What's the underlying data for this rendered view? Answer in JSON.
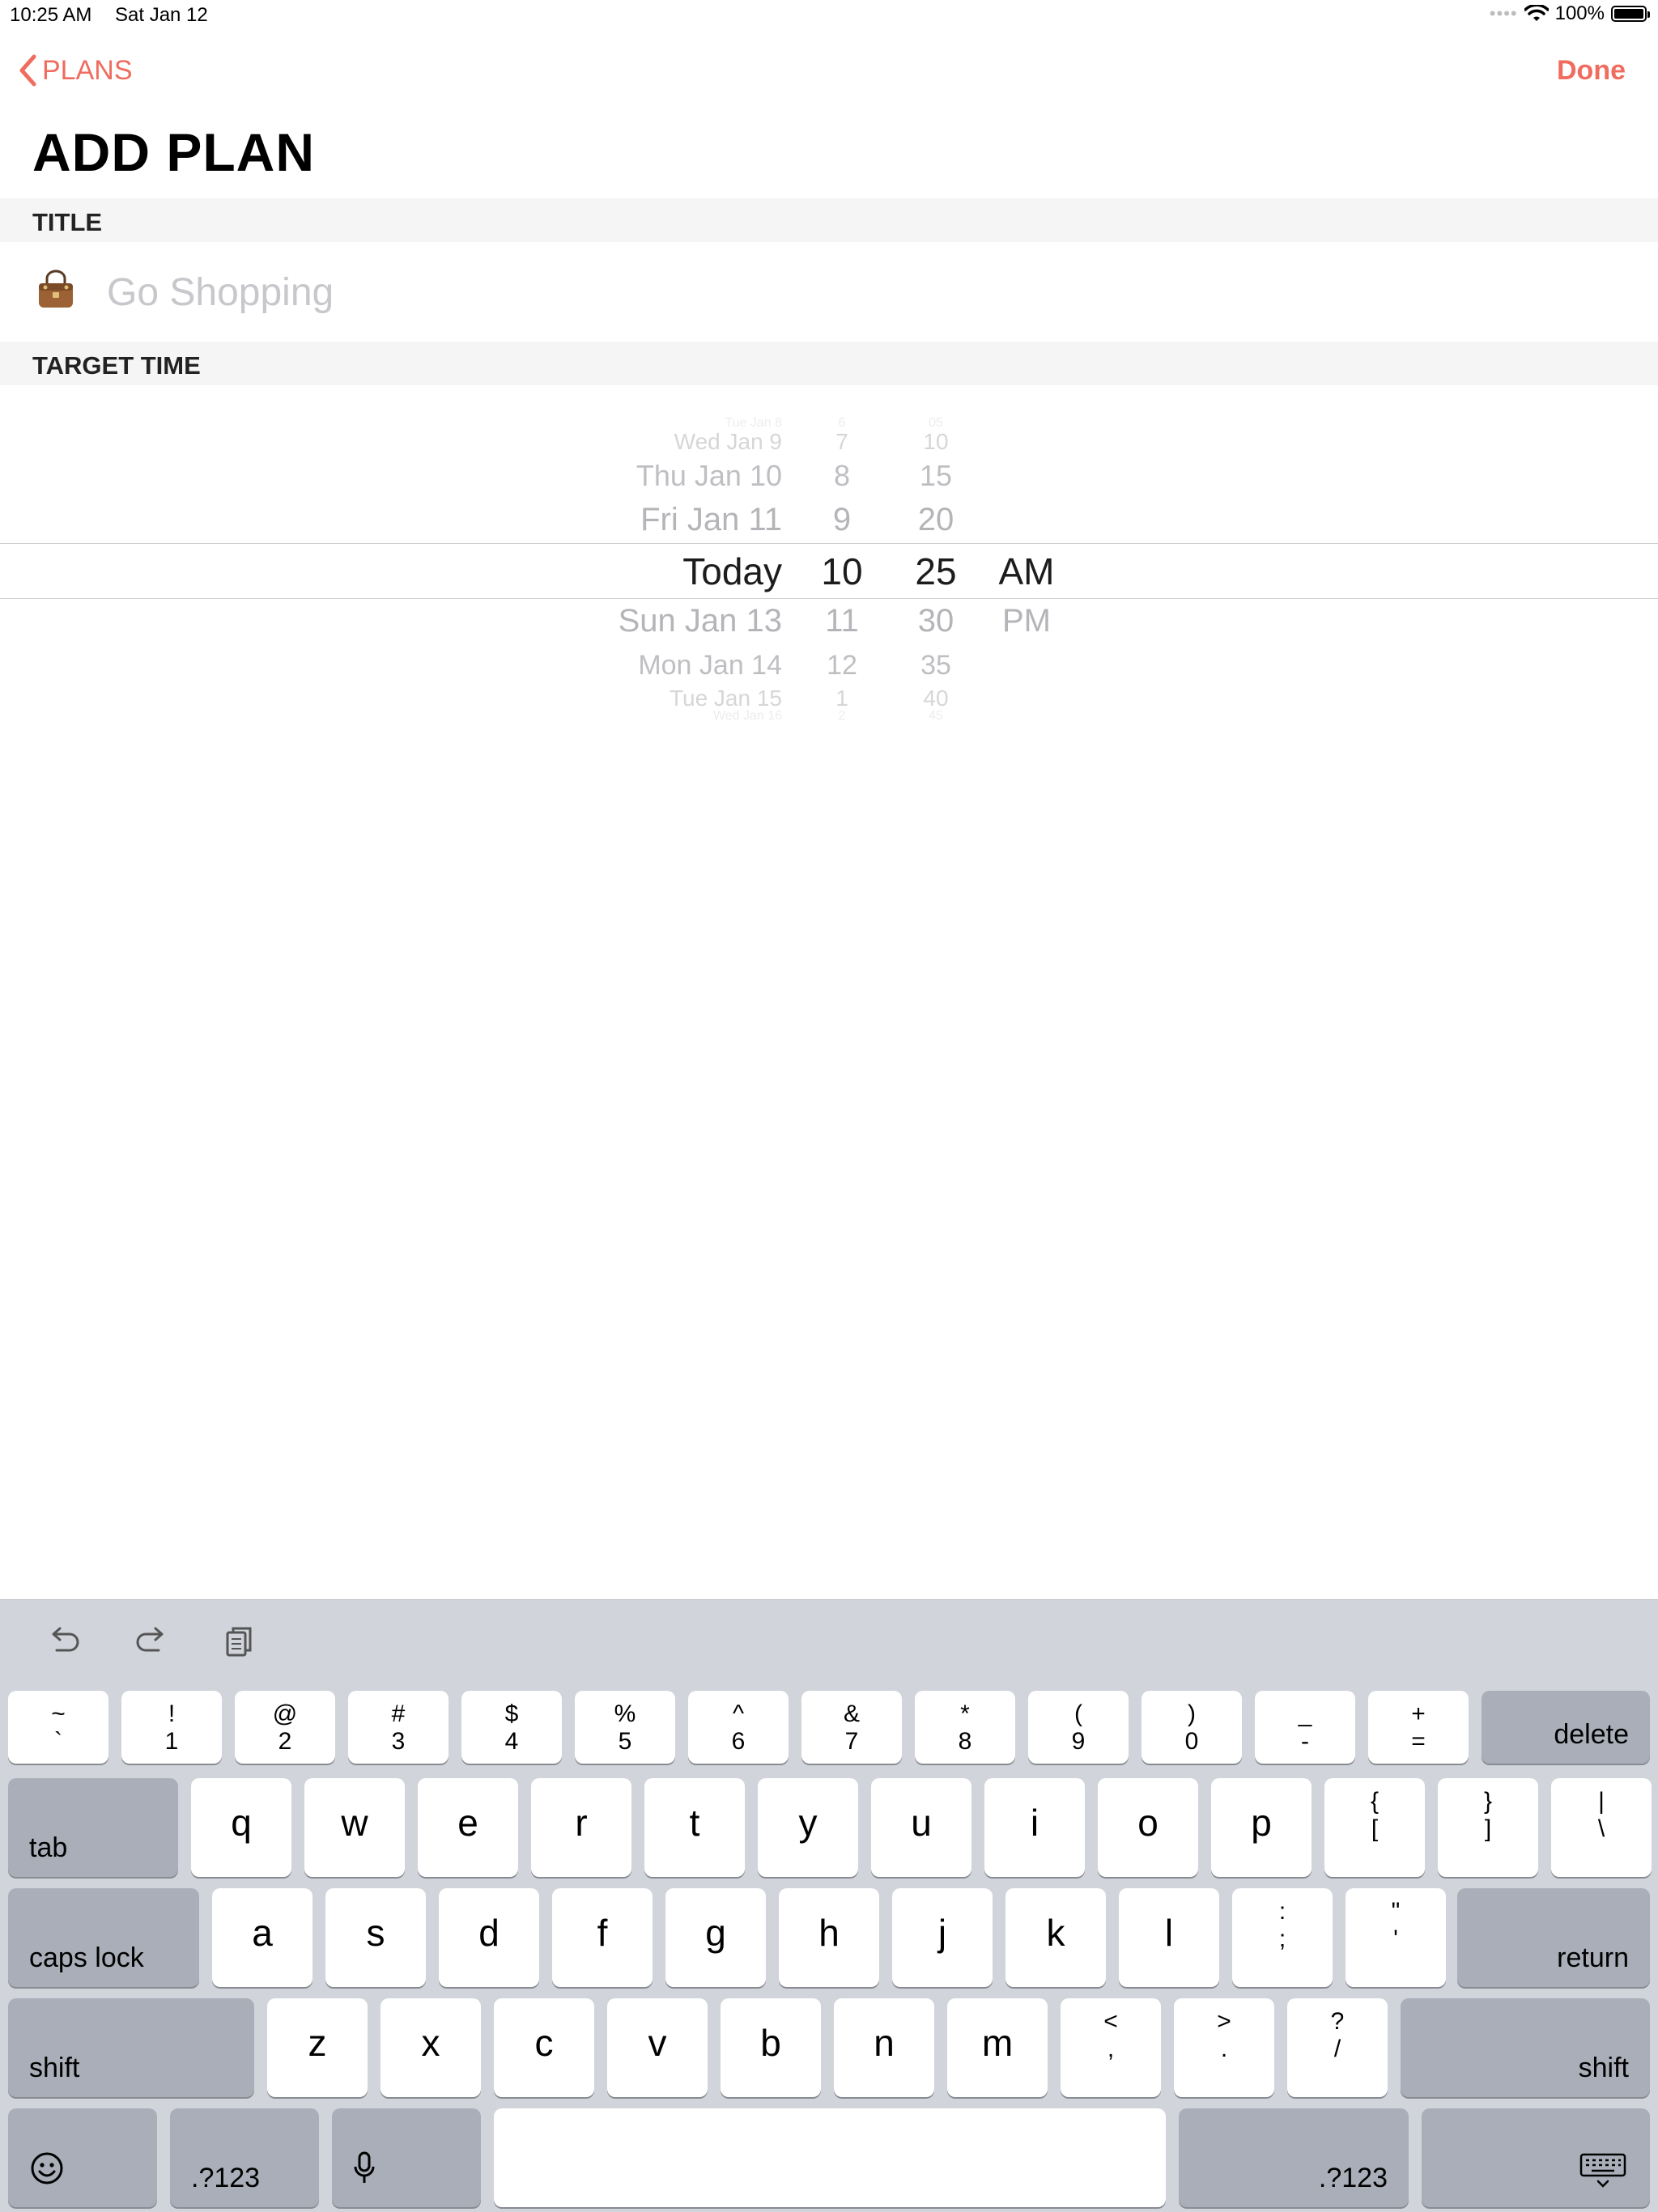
{
  "status_bar": {
    "time": "10:25 AM",
    "date": "Sat Jan 12",
    "battery": "100%"
  },
  "nav": {
    "back_label": "PLANS",
    "done_label": "Done",
    "accent_color": "#ef6c5e"
  },
  "page_title": "ADD PLAN",
  "sections": {
    "title": "TITLE",
    "target_time": "TARGET TIME"
  },
  "title_field": {
    "icon": "handbag-icon",
    "value": "",
    "placeholder": "Go Shopping"
  },
  "picker": {
    "days": [
      "Tue Jan 8",
      "Wed Jan 9",
      "Thu Jan 10",
      "Fri Jan 11",
      "Today",
      "Sun Jan 13",
      "Mon Jan 14",
      "Tue Jan 15",
      "Wed Jan 16"
    ],
    "hours": [
      "6",
      "7",
      "8",
      "9",
      "10",
      "11",
      "12",
      "1",
      "2"
    ],
    "minutes": [
      "05",
      "10",
      "15",
      "20",
      "25",
      "30",
      "35",
      "40",
      "45"
    ],
    "periods": [
      "AM",
      "PM"
    ],
    "selected": {
      "day": "Today",
      "hour": "10",
      "minute": "25",
      "period": "AM"
    }
  },
  "keyboard": {
    "toolbar_icons": [
      "undo-icon",
      "redo-icon",
      "paste-icon"
    ],
    "number_row": [
      {
        "top": "~",
        "bottom": "`"
      },
      {
        "top": "!",
        "bottom": "1"
      },
      {
        "top": "@",
        "bottom": "2"
      },
      {
        "top": "#",
        "bottom": "3"
      },
      {
        "top": "$",
        "bottom": "4"
      },
      {
        "top": "%",
        "bottom": "5"
      },
      {
        "top": "^",
        "bottom": "6"
      },
      {
        "top": "&",
        "bottom": "7"
      },
      {
        "top": "*",
        "bottom": "8"
      },
      {
        "top": "(",
        "bottom": "9"
      },
      {
        "top": ")",
        "bottom": "0"
      },
      {
        "top": "_",
        "bottom": "-"
      },
      {
        "top": "+",
        "bottom": "="
      }
    ],
    "delete": "delete",
    "tab": "tab",
    "row_q": [
      "q",
      "w",
      "e",
      "r",
      "t",
      "y",
      "u",
      "i",
      "o",
      "p"
    ],
    "row_q_symbols": [
      {
        "top": "{",
        "bottom": "["
      },
      {
        "top": "}",
        "bottom": "]"
      },
      {
        "top": "|",
        "bottom": "\\"
      }
    ],
    "caps_lock": "caps lock",
    "row_a": [
      "a",
      "s",
      "d",
      "f",
      "g",
      "h",
      "j",
      "k",
      "l"
    ],
    "row_a_symbols": [
      {
        "top": ":",
        "bottom": ";"
      },
      {
        "top": "\"",
        "bottom": "'"
      }
    ],
    "return": "return",
    "shift": "shift",
    "row_z": [
      "z",
      "x",
      "c",
      "v",
      "b",
      "n",
      "m"
    ],
    "row_z_symbols": [
      {
        "top": "<",
        "bottom": ","
      },
      {
        "top": ">",
        "bottom": "."
      },
      {
        "top": "?",
        "bottom": "/"
      }
    ],
    "numbers_label": ".?123",
    "bottom_icons": [
      "emoji-icon",
      "microphone-icon",
      "keyboard-dismiss-icon"
    ],
    "space": ""
  }
}
